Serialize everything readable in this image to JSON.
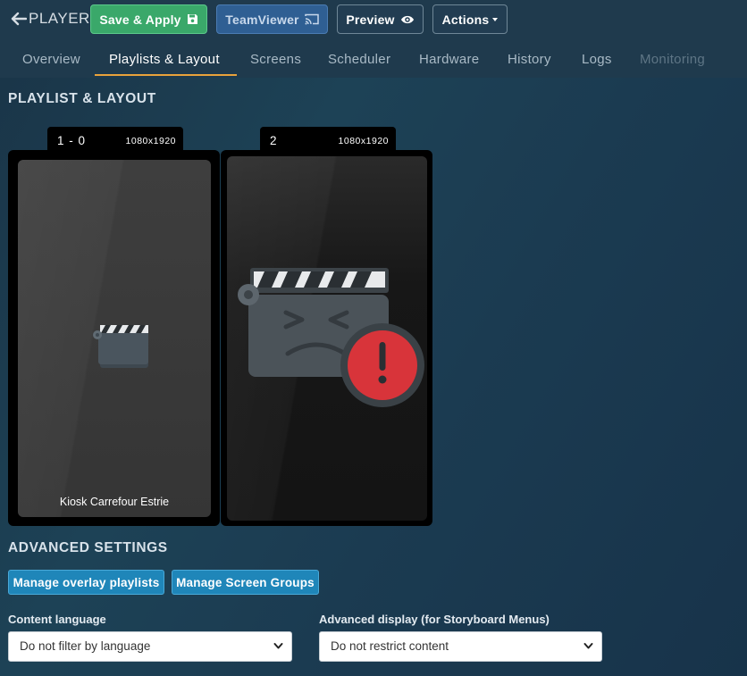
{
  "header": {
    "back_label": "PLAYER",
    "save_apply_label": "Save & Apply",
    "teamviewer_label": "TeamViewer",
    "preview_label": "Preview",
    "actions_label": "Actions"
  },
  "tabs": [
    {
      "label": "Overview",
      "state": "normal"
    },
    {
      "label": "Playlists & Layout",
      "state": "active"
    },
    {
      "label": "Screens",
      "state": "normal"
    },
    {
      "label": "Scheduler",
      "state": "normal"
    },
    {
      "label": "Hardware",
      "state": "normal"
    },
    {
      "label": "History",
      "state": "normal"
    },
    {
      "label": "Logs",
      "state": "normal"
    },
    {
      "label": "Monitoring",
      "state": "disabled"
    }
  ],
  "playlist_layout": {
    "title": "PLAYLIST & LAYOUT",
    "zones": [
      {
        "name": "1 - 0",
        "resolution": "1080x1920",
        "content_label": "Kiosk Carrefour Estrie",
        "icon": "clapperboard-icon"
      },
      {
        "name": "2",
        "resolution": "1080x1920",
        "content_label": "",
        "icon": "clapperboard-error-icon"
      }
    ]
  },
  "advanced_settings": {
    "title": "ADVANCED SETTINGS",
    "manage_overlay_label": "Manage overlay playlists",
    "manage_groups_label": "Manage Screen Groups",
    "content_language": {
      "label": "Content language",
      "selected": "Do not filter by language"
    },
    "advanced_display": {
      "label": "Advanced display (for Storyboard Menus)",
      "selected": "Do not restrict content"
    }
  },
  "colors": {
    "save_green": "#3aa86a",
    "teamviewer_blue": "#2f5f93",
    "tab_underline": "#e9a23b",
    "action_blue": "#1f86b9",
    "error_red": "#d8343a"
  }
}
